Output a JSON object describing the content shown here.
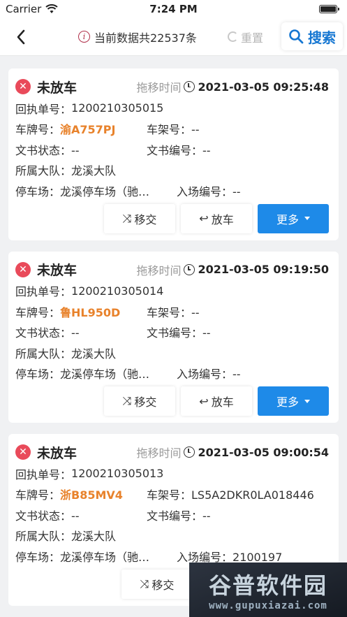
{
  "status_bar": {
    "carrier": "Carrier",
    "time": "7:24 PM"
  },
  "nav": {
    "info_text": "当前数据共22537条",
    "reset_label": "重置",
    "search_label": "搜索"
  },
  "labels": {
    "tow_time": "拖移时间",
    "receipt_no": "回执单号：",
    "plate_no": "车牌号：",
    "frame_no": "车架号：",
    "doc_status": "文书状态：",
    "doc_no": "文书编号：",
    "brigade": "所属大队：",
    "lot": "停车场：",
    "entry_no": "入场编号："
  },
  "buttons": {
    "transfer": "移交",
    "release": "放车",
    "more": "更多"
  },
  "records": [
    {
      "status": "未放车",
      "tow_time": "2021-03-05 09:25:48",
      "receipt_no": "1200210305015",
      "plate": "渝A757PJ",
      "frame": "--",
      "doc_status": "--",
      "doc_no": "--",
      "brigade": "龙溪大队",
      "lot": "龙溪停车场（驰…",
      "entry_no": "--"
    },
    {
      "status": "未放车",
      "tow_time": "2021-03-05 09:19:50",
      "receipt_no": "1200210305014",
      "plate": "鲁HL950D",
      "frame": "--",
      "doc_status": "--",
      "doc_no": "--",
      "brigade": "龙溪大队",
      "lot": "龙溪停车场（驰…",
      "entry_no": "--"
    },
    {
      "status": "未放车",
      "tow_time": "2021-03-05 09:00:54",
      "receipt_no": "1200210305013",
      "plate": "浙B85MV4",
      "frame": "LS5A2DKR0LA018446",
      "doc_status": "--",
      "doc_no": "--",
      "brigade": "龙溪大队",
      "lot": "龙溪停车场（驰…",
      "entry_no": "2100197"
    }
  ],
  "watermark": {
    "name": "谷普软件园",
    "url": "www.gupuxiazai.com"
  },
  "colors": {
    "accent": "#1e8ae8",
    "plate": "#e8822b",
    "status_red": "#e94a5a"
  }
}
